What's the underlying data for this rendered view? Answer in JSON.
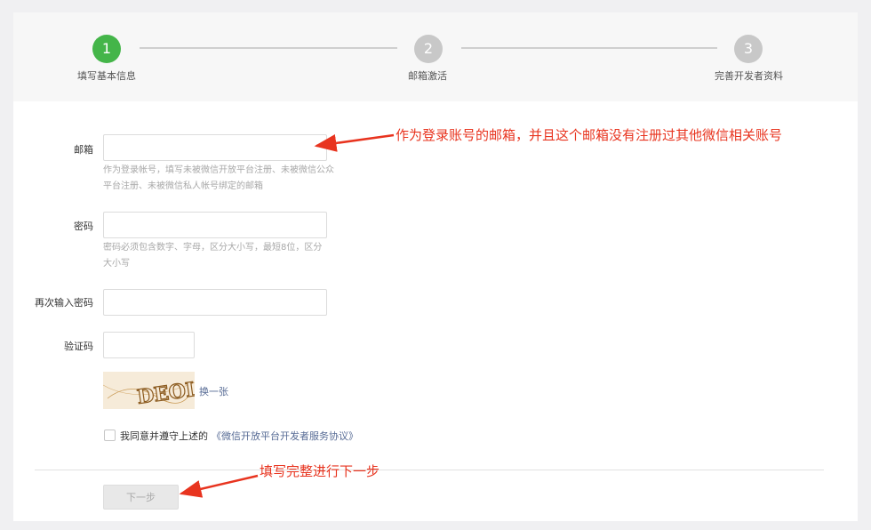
{
  "steps": [
    {
      "number": "1",
      "label": "填写基本信息",
      "state": "active"
    },
    {
      "number": "2",
      "label": "邮箱激活",
      "state": "inactive"
    },
    {
      "number": "3",
      "label": "完善开发者资料",
      "state": "inactive"
    }
  ],
  "form": {
    "email": {
      "label": "邮箱",
      "value": "",
      "hint": "作为登录帐号，填写未被微信开放平台注册、未被微信公众平台注册、未被微信私人帐号绑定的邮箱"
    },
    "password": {
      "label": "密码",
      "value": "",
      "hint": "密码必须包含数字、字母，区分大小写，最短8位，区分大小写"
    },
    "confirm_password": {
      "label": "再次输入密码",
      "value": ""
    },
    "captcha": {
      "label": "验证码",
      "value": "",
      "image_text": "DEOL",
      "refresh_label": "换一张"
    },
    "agreement": {
      "text": "我同意并遵守上述的",
      "link": "《微信开放平台开发者服务协议》",
      "checked": false
    },
    "next_button": "下一步"
  },
  "annotations": {
    "email_note": "作为登录账号的邮箱，并且这个邮箱没有注册过其他微信相关账号",
    "next_note": "填写完整进行下一步"
  },
  "colors": {
    "active_step": "#44b549",
    "inactive_step": "#c8c8c8",
    "link": "#576b95",
    "annotation": "#e8341f",
    "page_bg": "#f0f0f2"
  }
}
